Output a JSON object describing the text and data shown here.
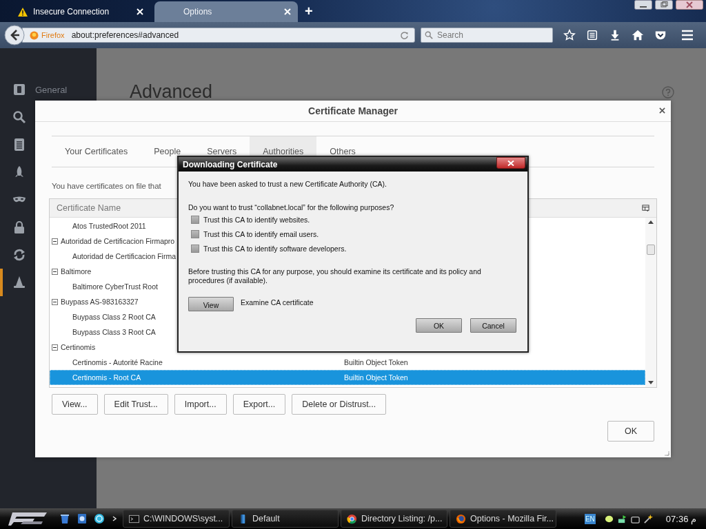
{
  "browser": {
    "tabs": [
      {
        "title": "Insecure Connection",
        "selected": false,
        "warning": true
      },
      {
        "title": "Options",
        "selected": true,
        "warning": false
      }
    ],
    "new_tab": "+",
    "identity": "Firefox",
    "url": "about:preferences#advanced",
    "search": {
      "placeholder": "Search"
    }
  },
  "sidebar": {
    "items": [
      {
        "kind": "general",
        "label": "General",
        "selected": false
      },
      {
        "kind": "search",
        "selected": false
      },
      {
        "kind": "content",
        "selected": false
      },
      {
        "kind": "applications",
        "selected": false
      },
      {
        "kind": "privacy",
        "selected": false
      },
      {
        "kind": "security",
        "selected": false
      },
      {
        "kind": "sync",
        "selected": false
      },
      {
        "kind": "advanced",
        "selected": true
      }
    ]
  },
  "page": {
    "heading": "Advanced"
  },
  "certificate_manager": {
    "title": "Certificate Manager",
    "tabs": [
      {
        "label": "Your Certificates",
        "selected": false
      },
      {
        "label": "People",
        "selected": false
      },
      {
        "label": "Servers",
        "selected": false
      },
      {
        "label": "Authorities",
        "selected": true
      },
      {
        "label": "Others",
        "selected": false
      }
    ],
    "description": "You have certificates on file that",
    "columns": [
      "Certificate Name"
    ],
    "rows": [
      {
        "children": [
          {
            "name": "Atos TrustedRoot 2011",
            "selected": false
          }
        ]
      },
      {
        "group": "Autoridad de Certificacion Firmapro",
        "expanded": true,
        "children": [
          {
            "name": "Autoridad de Certificacion Firma",
            "selected": false
          }
        ]
      },
      {
        "group": "Baltimore",
        "expanded": true,
        "children": [
          {
            "name": "Baltimore CyberTrust Root",
            "selected": false
          }
        ]
      },
      {
        "group": "Buypass AS-983163327",
        "expanded": true,
        "children": [
          {
            "name": "Buypass Class 2 Root CA",
            "selected": false
          },
          {
            "name": "Buypass Class 3 Root CA",
            "selected": false
          }
        ]
      },
      {
        "group": "Certinomis",
        "expanded": true,
        "children": [
          {
            "name": "Certinomis - Autorité Racine",
            "token": "Builtin Object Token",
            "selected": false
          },
          {
            "name": "Certinomis - Root CA",
            "token": "Builtin Object Token",
            "selected": true
          }
        ]
      }
    ],
    "buttons": [
      "View...",
      "Edit Trust...",
      "Import...",
      "Export...",
      "Delete or Distrust..."
    ],
    "ok": "OK"
  },
  "download_dialog": {
    "title": "Downloading Certificate",
    "intro": "You have been asked to trust a new Certificate Authority (CA).",
    "question": "Do you want to trust “collabnet.local” for the following purposes?",
    "options": [
      {
        "label": "Trust this CA to identify websites.",
        "checked": false
      },
      {
        "label": "Trust this CA to identify email users.",
        "checked": false
      },
      {
        "label": "Trust this CA to identify software developers.",
        "checked": false
      }
    ],
    "advice": "Before trusting this CA for any purpose, you should examine its certificate and its policy and procedures (if available).",
    "view_button": "View",
    "view_caption": "Examine CA certificate",
    "buttons": [
      "OK",
      "Cancel"
    ]
  },
  "taskbar": {
    "tasks": [
      {
        "kind": "cmd",
        "label": "C:\\WINDOWS\\syst..."
      },
      {
        "kind": "folder",
        "label": "Default"
      },
      {
        "kind": "chrome",
        "label": "Directory Listing: /p..."
      },
      {
        "kind": "firefox",
        "label": "Options - Mozilla Fir..."
      }
    ],
    "language": "EN",
    "clock": "07:36 م"
  }
}
